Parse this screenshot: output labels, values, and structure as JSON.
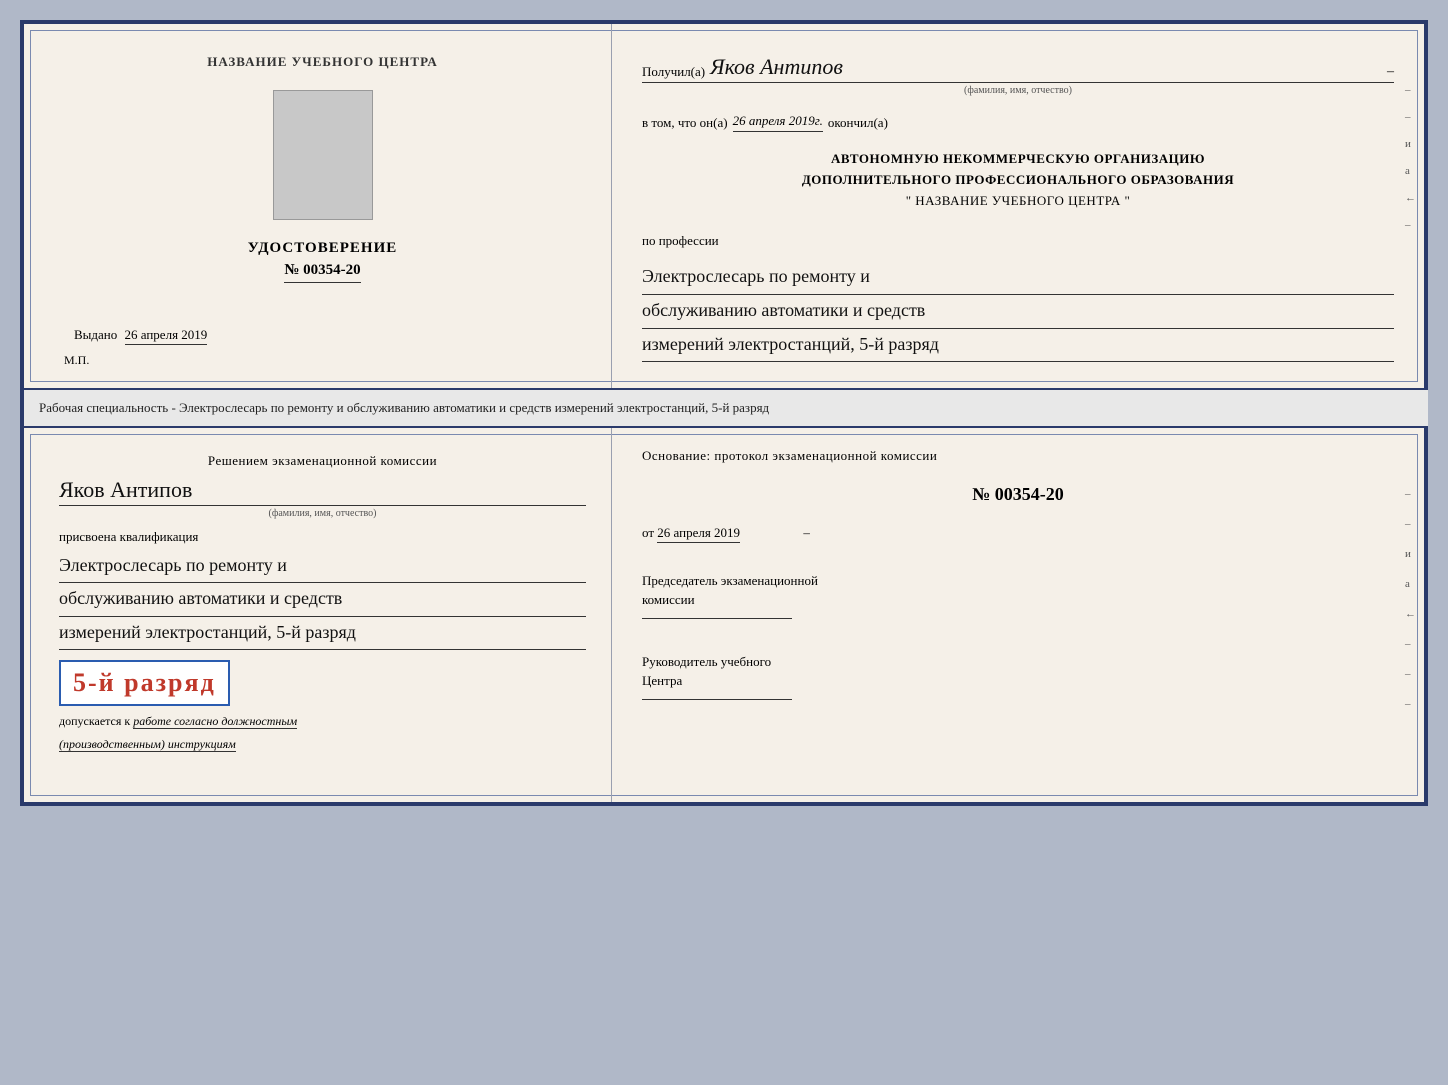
{
  "topCert": {
    "leftSide": {
      "orgNamePlaceholder": "НАЗВАНИЕ УЧЕБНОГО ЦЕНТРА",
      "certTitle": "УДОСТОВЕРЕНИЕ",
      "certNumber": "№ 00354-20",
      "issuedLabel": "Выдано",
      "issuedDate": "26 апреля 2019",
      "mpLabel": "М.П."
    },
    "rightSide": {
      "recipientPrefix": "Получил(а)",
      "recipientName": "Яков Антипов",
      "fioHint": "(фамилия, имя, отчество)",
      "datePrefix": "в том, что он(а)",
      "dateValue": "26 апреля 2019г.",
      "dateSuffix": "окончил(а)",
      "orgLine1": "АВТОНОМНУЮ НЕКОММЕРЧЕСКУЮ ОРГАНИЗАЦИЮ",
      "orgLine2": "ДОПОЛНИТЕЛЬНОГО ПРОФЕССИОНАЛЬНОГО ОБРАЗОВАНИЯ",
      "orgLine3": "\"   НАЗВАНИЕ УЧЕБНОГО ЦЕНТРА   \"",
      "professionLabel": "по профессии",
      "professionLine1": "Электрослесарь по ремонту и",
      "professionLine2": "обслуживанию автоматики и средств",
      "professionLine3": "измерений электростанций, 5-й разряд"
    }
  },
  "betweenLabel": "Рабочая специальность - Электрослесарь по ремонту и обслуживанию автоматики и средств\nизмерений электростанций, 5-й разряд",
  "bottomCert": {
    "leftSide": {
      "decisionLine": "Решением экзаменационной комиссии",
      "decisionName": "Яков Антипов",
      "fioHint": "(фамилия, имя, отчество)",
      "assignedLabel": "присвоена квалификация",
      "qualLine1": "Электрослесарь по ремонту и",
      "qualLine2": "обслуживанию автоматики и средств",
      "qualLine3": "измерений электростанций, 5-й разряд",
      "rankBadge": "5-й разряд",
      "admittedPrefix": "допускается к",
      "admittedItalic": "работе согласно должностным",
      "admittedItalic2": "(производственным) инструкциям"
    },
    "rightSide": {
      "basisLabel": "Основание: протокол экзаменационной комиссии",
      "protocolNumber": "№ 00354-20",
      "protocolDatePrefix": "от",
      "protocolDateValue": "26 апреля 2019",
      "chairmanLabel": "Председатель экзаменационной\nкомиссии",
      "directorLabel": "Руководитель учебного\nЦентра"
    }
  }
}
